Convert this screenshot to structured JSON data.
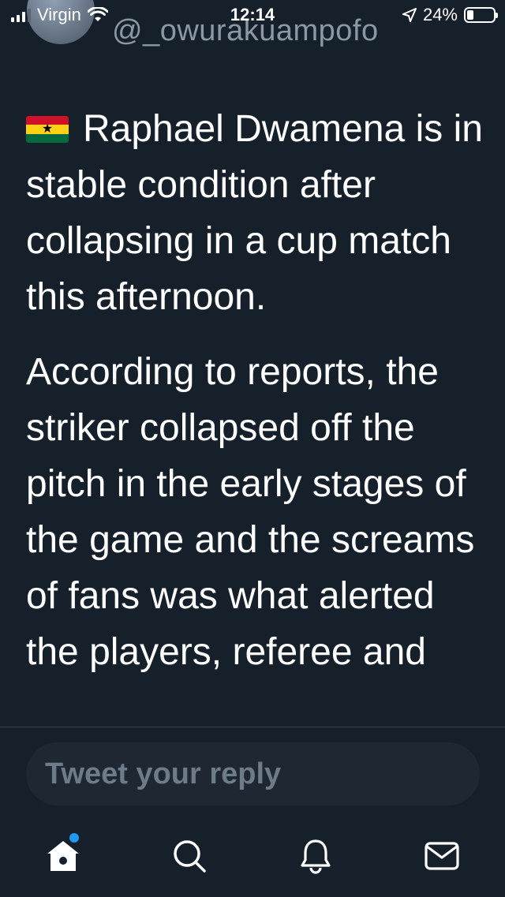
{
  "status_bar": {
    "carrier": "Virgin",
    "time": "12:14",
    "battery_percent": "24%",
    "battery_level": 0.24
  },
  "header": {
    "handle": "@_owurakuampofo"
  },
  "tweet": {
    "flag": "Ghana flag",
    "paragraphs": [
      "Raphael Dwamena is in stable condition after collapsing in a cup match this afternoon.",
      "According to reports, the striker collapsed off the pitch in the early stages of the game and the screams of fans was what alerted the players, referee and"
    ]
  },
  "reply": {
    "placeholder": "Tweet your reply"
  },
  "tabs": [
    {
      "icon": "home-icon",
      "has_notification": true
    },
    {
      "icon": "search-icon"
    },
    {
      "icon": "bell-icon"
    },
    {
      "icon": "mail-icon"
    }
  ],
  "colors": {
    "background": "#15202b",
    "accent": "#1d9bf0",
    "muted": "#8b98a5"
  }
}
